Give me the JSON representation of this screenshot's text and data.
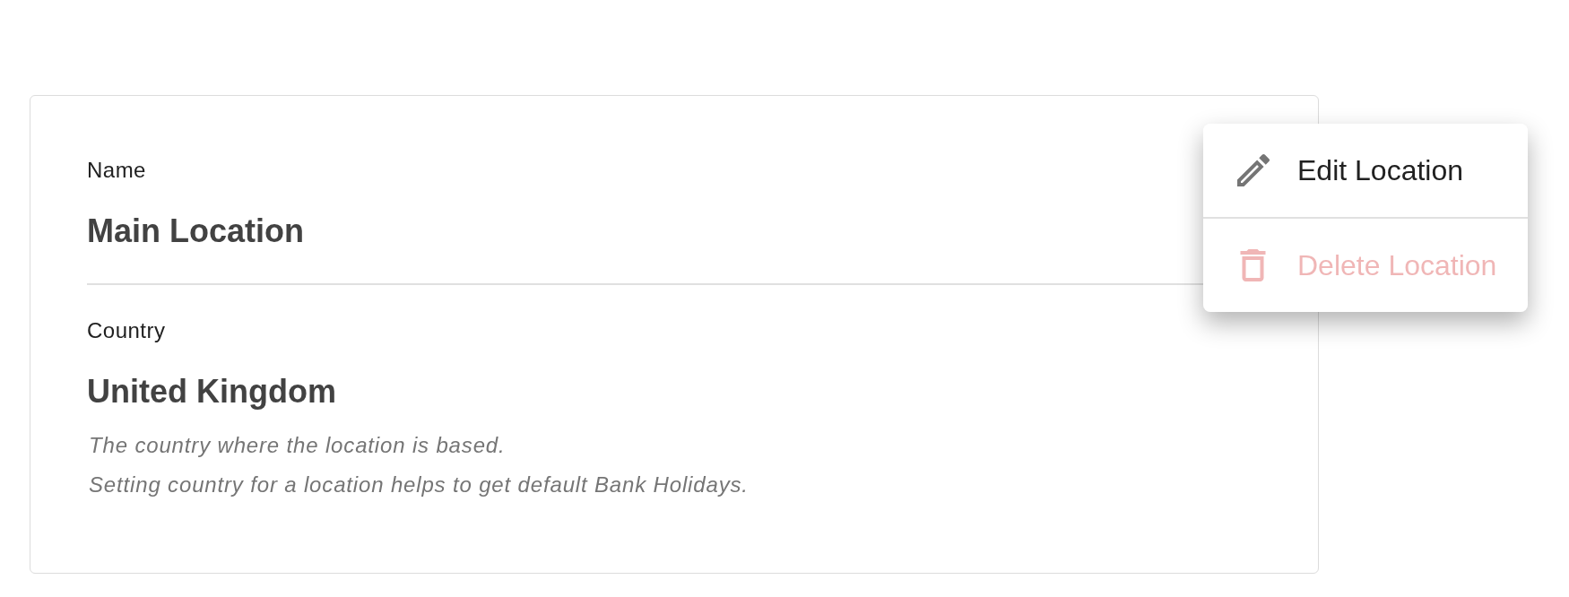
{
  "fields": [
    {
      "label": "Name",
      "value": "Main Location"
    },
    {
      "label": "Country",
      "value": "United Kingdom",
      "hint_lines": [
        "The country where the location is based.",
        "Setting country for a location helps to get default Bank Holidays."
      ]
    }
  ],
  "menu": {
    "items": [
      {
        "kind": "edit",
        "label": "Edit Location",
        "disabled": false
      },
      {
        "kind": "delete",
        "label": "Delete Location",
        "disabled": true
      }
    ]
  }
}
